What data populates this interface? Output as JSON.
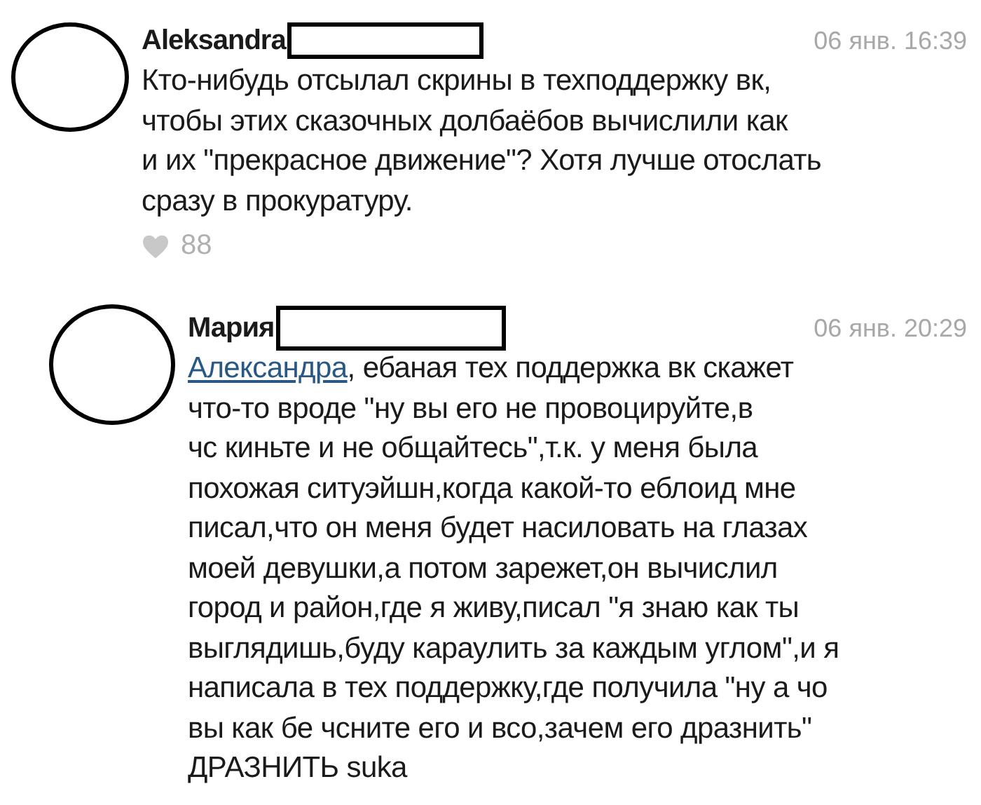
{
  "comments": [
    {
      "author": "Aleksandra",
      "date": "06 янв. 16:39",
      "text": "Кто-нибудь отсылал скрины в техподдержку вк,\nчтобы этих сказочных долбаёбов вычислили как\nи их \"прекрасное движение\"? Хотя лучше отослать\nсразу в прокуратуру.",
      "likes": "88",
      "reply": false
    },
    {
      "author": "Мария",
      "date": "06 янв. 20:29",
      "mention": "Александра",
      "text": ", ебаная тех поддержка вк скажет\nчто-то вроде \"ну вы его не провоцируйте,в\nчс киньте и не общайтесь\",т.к. у меня была\nпохожая ситуэйшн,когда какой-то еблоид мне\nписал,что он меня будет насиловать на глазах\nмоей девушки,а потом зарежет,он вычислил\nгород и район,где я живу,писал \"я знаю как ты\nвыглядишь,буду караулить за каждым углом\",и я\nнаписала в тех поддержку,где получила \"ну а чо\nвы как бе чсните его и всо,зачем его дразнить\"\nДРАЗНИТЬ suka",
      "reply": true
    }
  ]
}
